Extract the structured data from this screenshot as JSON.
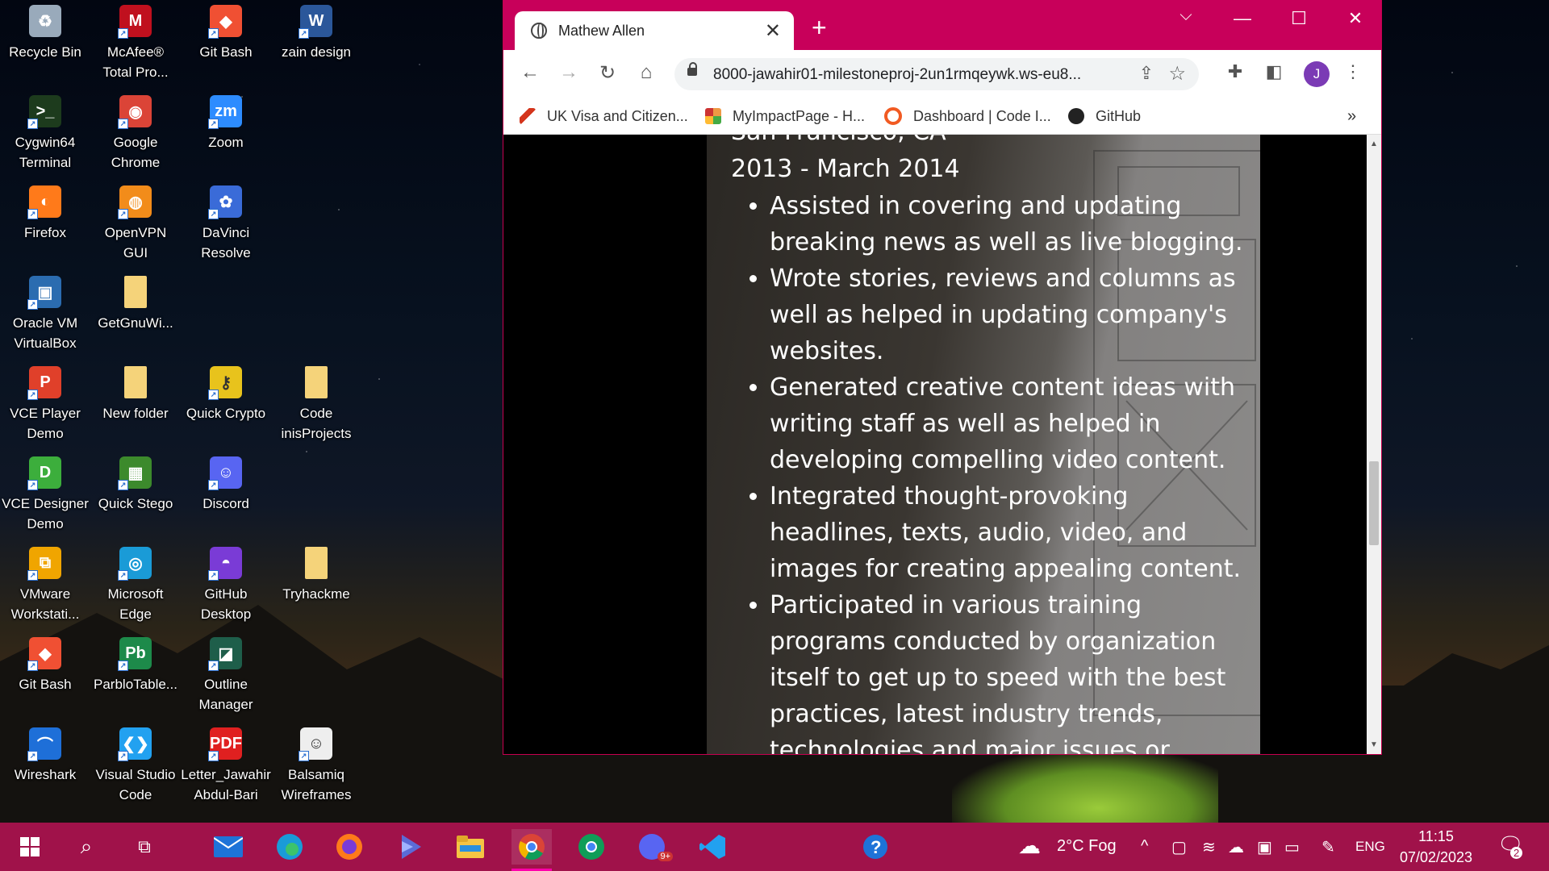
{
  "desktop": {
    "icons": [
      {
        "label": "Recycle Bin",
        "icon": "recycle-bin-icon"
      },
      {
        "label": "McAfee® Total Pro...",
        "icon": "mcafee-icon"
      },
      {
        "label": "Git Bash",
        "icon": "git-bash-icon"
      },
      {
        "label": "zain design",
        "icon": "word-document-icon"
      },
      {
        "label": "Cygwin64 Terminal",
        "icon": "cygwin-terminal-icon"
      },
      {
        "label": "Google Chrome",
        "icon": "chrome-icon"
      },
      {
        "label": "Zoom",
        "icon": "zoom-icon"
      },
      {
        "label": "Firefox",
        "icon": "firefox-icon"
      },
      {
        "label": "OpenVPN GUI",
        "icon": "openvpn-icon"
      },
      {
        "label": "DaVinci Resolve",
        "icon": "davinci-resolve-icon"
      },
      {
        "label": "Oracle VM VirtualBox",
        "icon": "virtualbox-icon"
      },
      {
        "label": "GetGnuWi...",
        "icon": "folder-icon"
      },
      {
        "label": "VCE Player Demo",
        "icon": "vce-player-icon"
      },
      {
        "label": "New folder",
        "icon": "folder-icon"
      },
      {
        "label": "Quick Crypto",
        "icon": "quick-crypto-icon"
      },
      {
        "label": "Code inisProjects",
        "icon": "folder-icon"
      },
      {
        "label": "VCE Designer Demo",
        "icon": "vce-designer-icon"
      },
      {
        "label": "Quick Stego",
        "icon": "quick-stego-icon"
      },
      {
        "label": "Discord",
        "icon": "discord-icon"
      },
      {
        "label": "VMware Workstati...",
        "icon": "vmware-icon"
      },
      {
        "label": "Microsoft Edge",
        "icon": "edge-icon"
      },
      {
        "label": "GitHub Desktop",
        "icon": "github-desktop-icon"
      },
      {
        "label": "Tryhackme",
        "icon": "folder-icon"
      },
      {
        "label": "Git Bash",
        "icon": "git-bash-icon"
      },
      {
        "label": "ParbloTable...",
        "icon": "parblo-icon"
      },
      {
        "label": "Outline Manager",
        "icon": "outline-manager-icon"
      },
      {
        "label": "Wireshark",
        "icon": "wireshark-icon"
      },
      {
        "label": "Visual Studio Code",
        "icon": "vscode-icon"
      },
      {
        "label": "Letter_Jawahir Abdul-Bari",
        "icon": "pdf-icon"
      },
      {
        "label": "Balsamiq Wireframes",
        "icon": "balsamiq-icon"
      }
    ]
  },
  "browser": {
    "tab_title": "Mathew Allen",
    "url": "8000-jawahir01-milestoneproj-2un1rmqeywk.ws-eu8...",
    "avatar_letter": "J",
    "bookmarks": [
      {
        "label": "UK Visa and Citizen...",
        "icon": "uk-gov-icon"
      },
      {
        "label": "MyImpactPage - H...",
        "icon": "grid-icon"
      },
      {
        "label": "Dashboard | Code I...",
        "icon": "code-institute-icon"
      },
      {
        "label": "GitHub",
        "icon": "github-icon"
      }
    ],
    "overflow_label": "»"
  },
  "resume": {
    "location": "San Francisco, CA",
    "dates": "2013 - March 2014",
    "bullets": [
      "Assisted in covering and updating breaking news as well as live blogging.",
      "Wrote stories, reviews and columns as well as helped in updating company's websites.",
      "Generated creative content ideas with writing staff as well as helped in developing compelling video content.",
      "Integrated thought-provoking headlines, texts, audio, video, and images for creating appealing content.",
      "Participated in various training programs conducted by organization itself to get up to speed with the best practices, latest industry trends, technologies and major issues or stories."
    ]
  },
  "taskbar": {
    "weather": "2°C  Fog",
    "language": "ENG",
    "time": "11:15",
    "date": "07/02/2023",
    "notification_count": "2",
    "discord_badge": "9+"
  },
  "colors": {
    "accent": "#c8005a",
    "taskbar": "#a0124a"
  }
}
